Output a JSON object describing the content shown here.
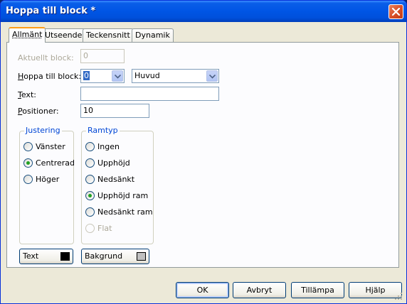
{
  "window": {
    "title": "Hoppa till block *"
  },
  "tabs": [
    {
      "label": "Allmänt",
      "active": true
    },
    {
      "label": "Utseende"
    },
    {
      "label": "Teckensnitt"
    },
    {
      "label": "Dynamik"
    }
  ],
  "form": {
    "current_block": {
      "label": "Aktuellt block:",
      "value": "0",
      "enabled": false
    },
    "jump_to_block": {
      "label": "Hoppa till block:",
      "block_value": "0",
      "target_value": "Huvud"
    },
    "text": {
      "label": "Text:",
      "value": ""
    },
    "positions": {
      "label": "Positioner:",
      "value": "10"
    }
  },
  "alignment_group": {
    "title": "Justering",
    "options": [
      {
        "label": "Vänster",
        "checked": false
      },
      {
        "label": "Centrerad",
        "checked": true
      },
      {
        "label": "Höger",
        "checked": false
      }
    ]
  },
  "frame_group": {
    "title": "Ramtyp",
    "options": [
      {
        "label": "Ingen",
        "checked": false
      },
      {
        "label": "Upphöjd",
        "checked": false
      },
      {
        "label": "Nedsänkt",
        "checked": false
      },
      {
        "label": "Upphöjd ram",
        "checked": true
      },
      {
        "label": "Nedsänkt ram",
        "checked": false
      },
      {
        "label": "Flat",
        "checked": false,
        "enabled": false
      }
    ]
  },
  "color_buttons": {
    "text": {
      "label": "Text",
      "color": "#000000"
    },
    "background": {
      "label": "Bakgrund",
      "color": "#c0c0c0"
    }
  },
  "buttons": {
    "ok": "OK",
    "cancel": "Avbryt",
    "apply": "Tillämpa",
    "help": "Hjälp"
  },
  "colors": {
    "title_bar": "#0055e5",
    "group_title": "#0046d5",
    "selection": "#316ac5",
    "radio_dot": "#21a121"
  }
}
